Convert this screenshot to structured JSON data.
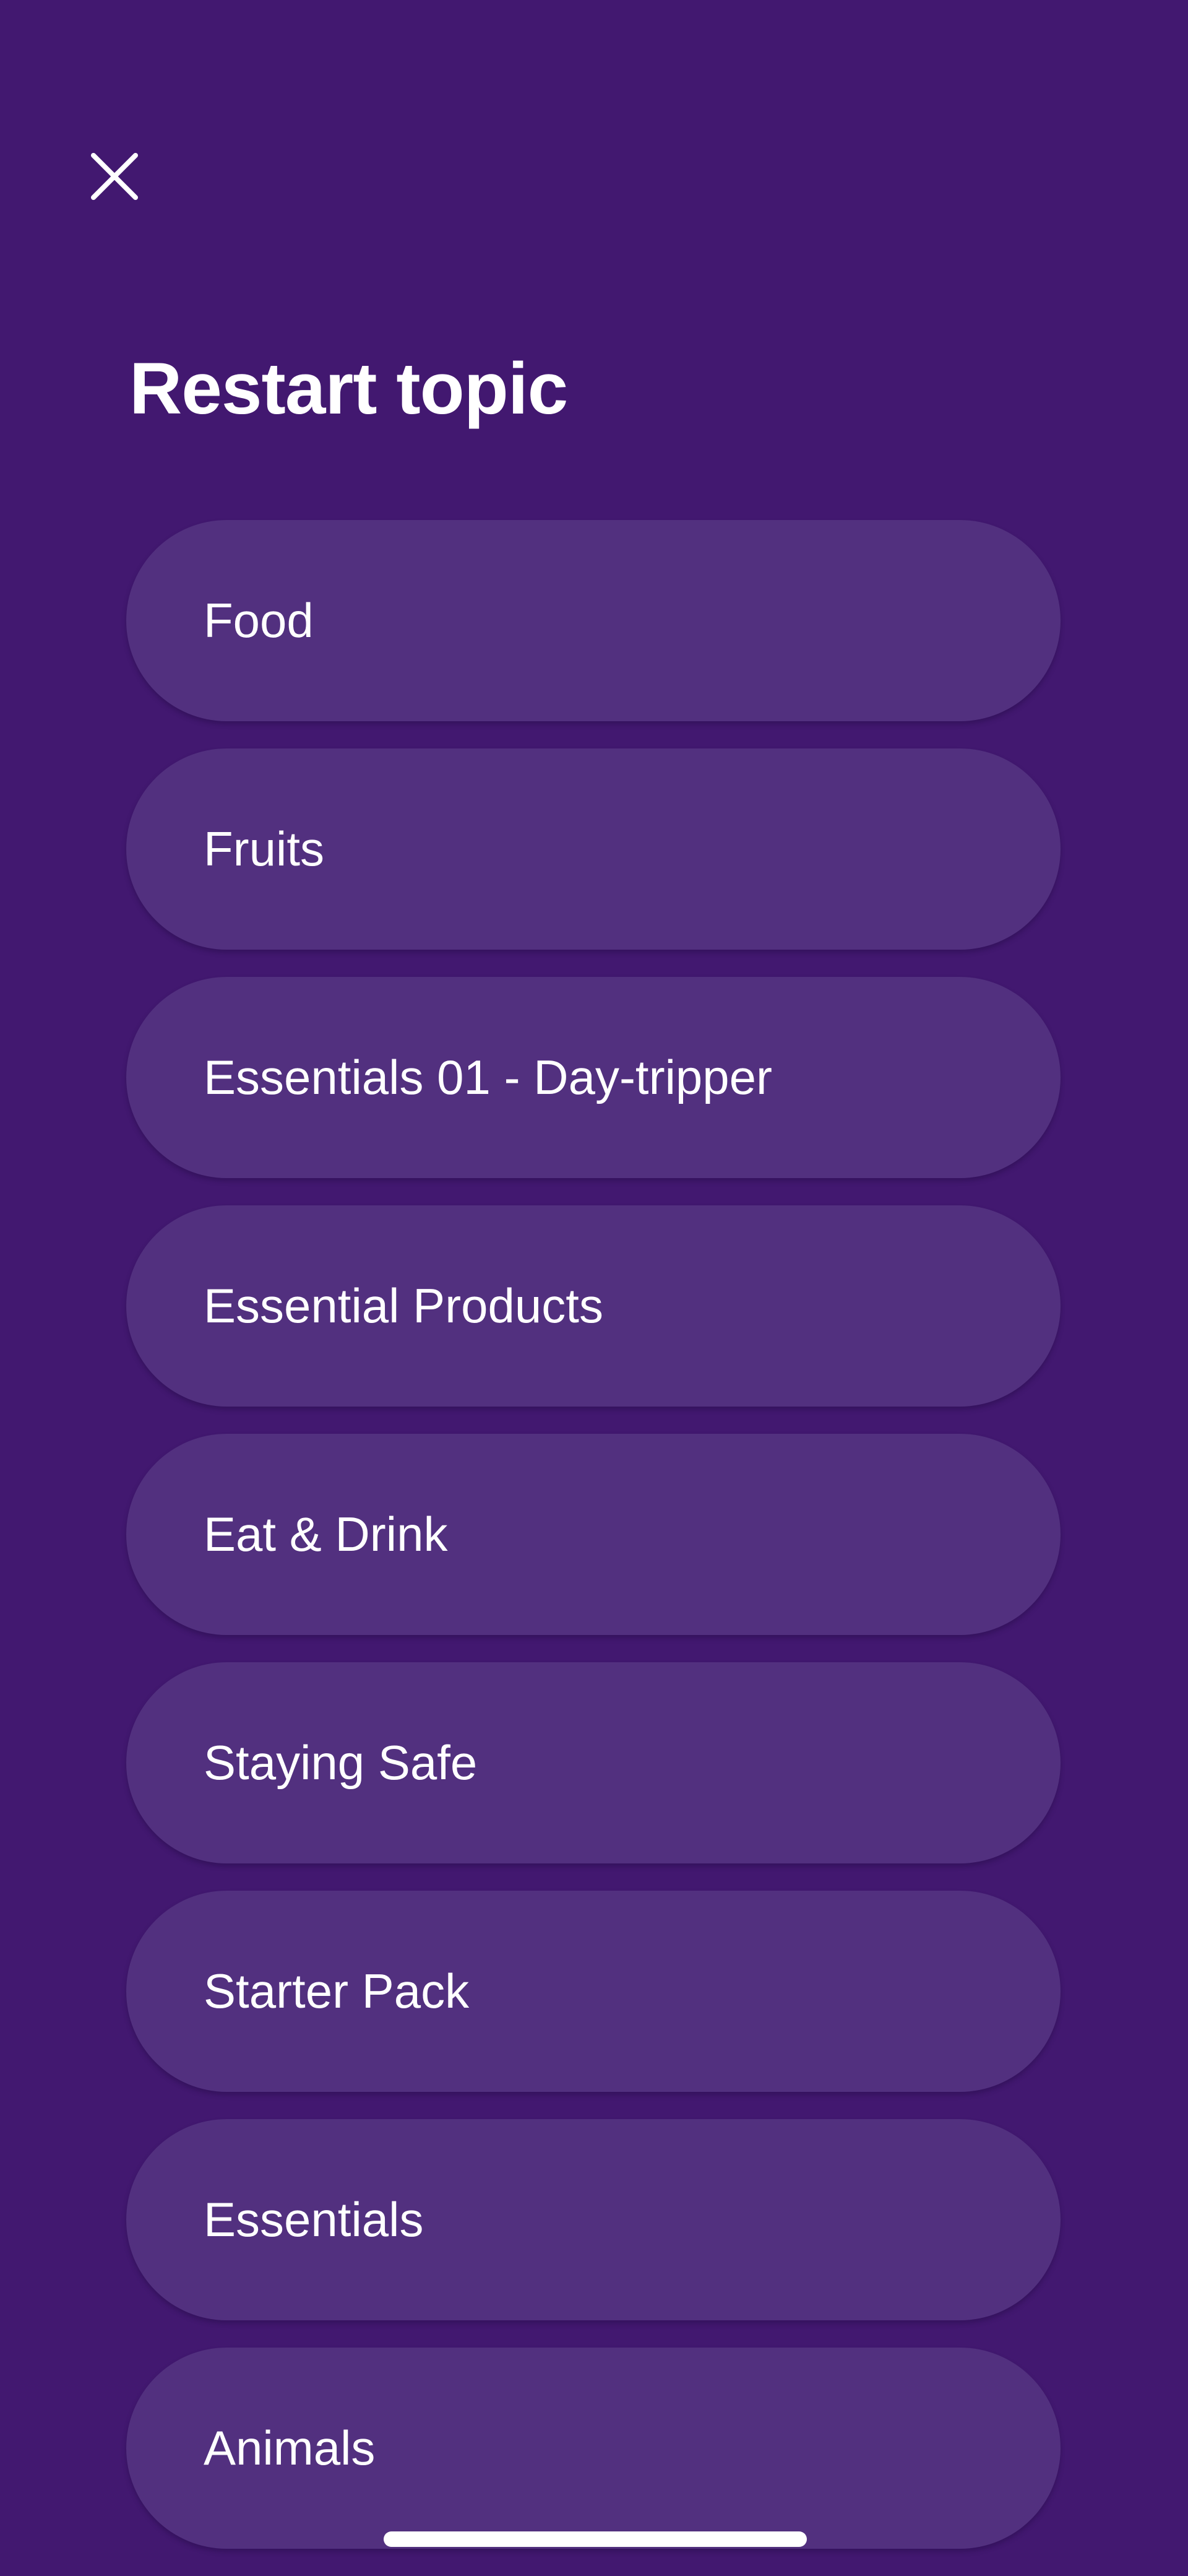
{
  "header": {
    "close_icon": "close-icon",
    "title": "Restart topic"
  },
  "topics": [
    {
      "label": "Food"
    },
    {
      "label": "Fruits"
    },
    {
      "label": "Essentials 01 - Day-tripper"
    },
    {
      "label": "Essential Products"
    },
    {
      "label": "Eat & Drink"
    },
    {
      "label": "Staying Safe"
    },
    {
      "label": "Starter Pack"
    },
    {
      "label": "Essentials"
    },
    {
      "label": "Animals"
    }
  ],
  "colors": {
    "background": "#421870",
    "topic_button": "#52307f",
    "text": "#ffffff"
  }
}
